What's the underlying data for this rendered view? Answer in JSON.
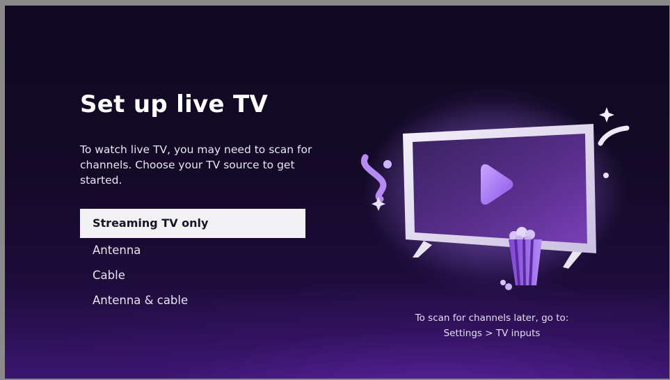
{
  "screen": {
    "title": "Set up live TV",
    "description": "To watch live TV, you may need to scan for channels. Choose your TV source to get started.",
    "options": [
      {
        "label": "Streaming TV only",
        "selected": true
      },
      {
        "label": "Antenna",
        "selected": false
      },
      {
        "label": "Cable",
        "selected": false
      },
      {
        "label": "Antenna & cable",
        "selected": false
      }
    ],
    "hint_line1": "To scan for channels later, go to:",
    "hint_line2": "Settings > TV inputs"
  },
  "icons": [
    "tv-illustration",
    "play-icon",
    "popcorn-icon",
    "sparkle-icon"
  ],
  "colors": {
    "accent": "#9b6cf0",
    "selected_bg": "#f2f1f3",
    "background_dark": "#120a24",
    "background_purple": "#5a24a8"
  }
}
